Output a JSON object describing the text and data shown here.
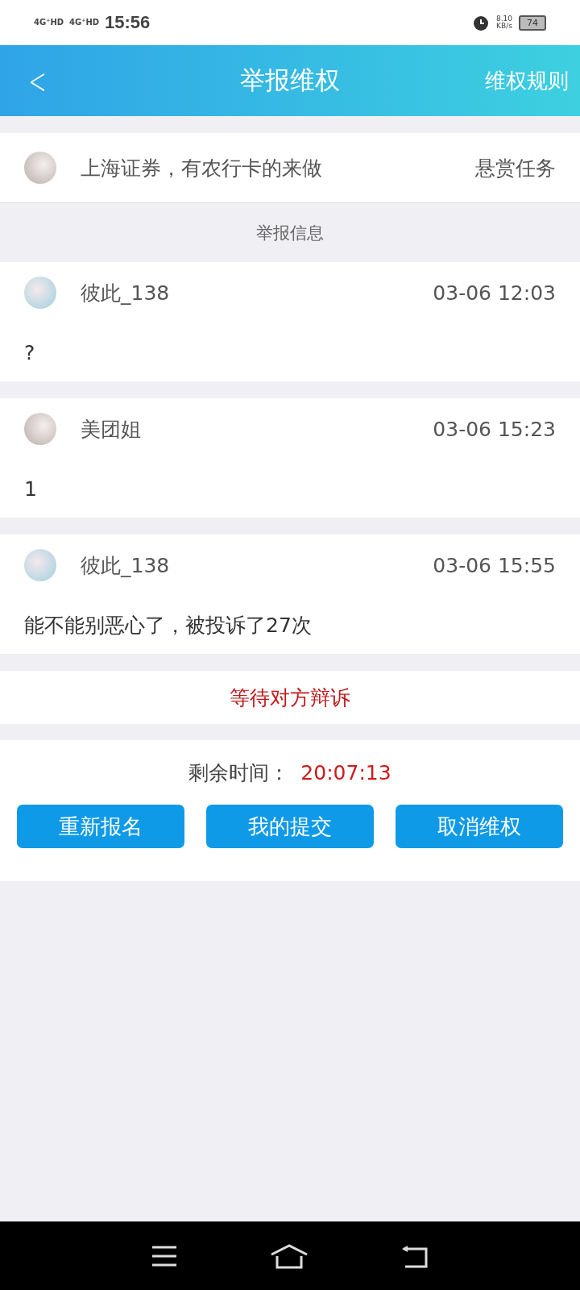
{
  "status_bar": {
    "network_1": "4G⁺HD",
    "network_2": "4G⁺HD",
    "time": "15:56",
    "speed_value": "8.10",
    "speed_unit": "KB/s",
    "battery": "74"
  },
  "header": {
    "back": "<",
    "title": "举报维权",
    "action": "维权规则"
  },
  "task": {
    "title": "上海证券，有农行卡的来做",
    "type": "悬赏任务"
  },
  "section_label": "举报信息",
  "posts": [
    {
      "user": "彼此_138",
      "time": "03-06 12:03",
      "text": "?"
    },
    {
      "user": "美团姐",
      "time": "03-06 15:23",
      "text": "1"
    },
    {
      "user": "彼此_138",
      "time": "03-06 15:55",
      "text": "能不能别恶心了，被投诉了27次"
    }
  ],
  "status": "等待对方辩诉",
  "countdown": {
    "label": "剩余时间：",
    "value": "20:07:13"
  },
  "buttons": [
    "重新报名",
    "我的提交",
    "取消维权"
  ]
}
